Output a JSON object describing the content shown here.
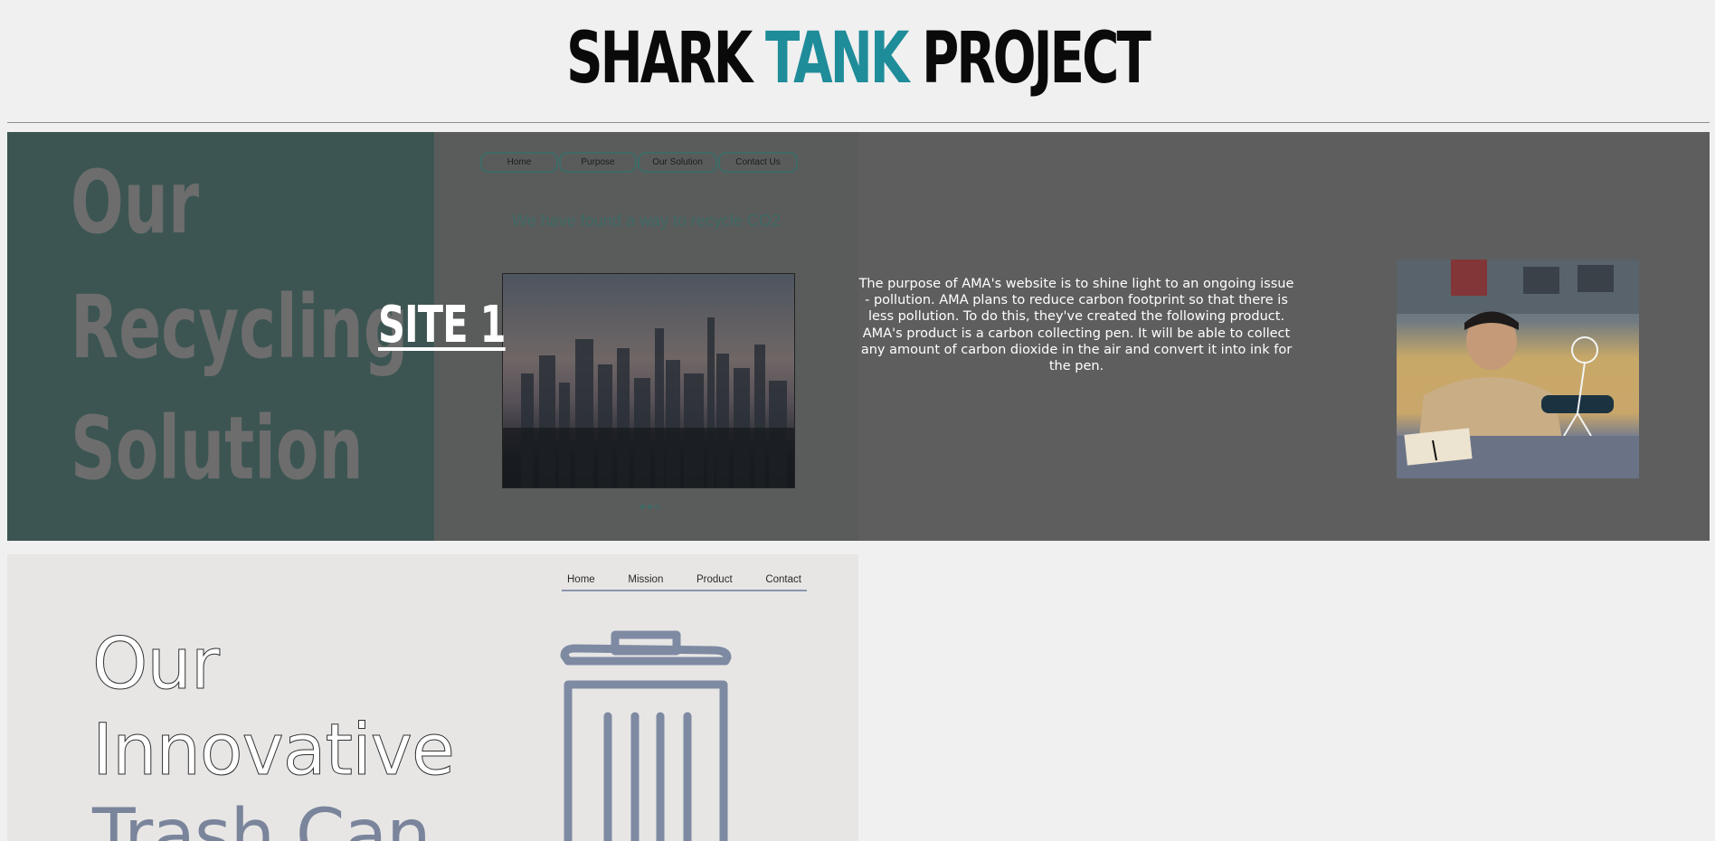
{
  "header": {
    "title_part1": "SHARK",
    "title_part2": "TANK",
    "title_part3": "PROJECT",
    "accent_color": "#1f8c99"
  },
  "site1": {
    "label": "SITE 1",
    "hero_lines": [
      "Our",
      "Recycling",
      "Solution"
    ],
    "nav": [
      "Home",
      "Purpose",
      "Our Solution",
      "Contact Us"
    ],
    "headline": "We have found a way to recycle CO2",
    "description": "The purpose of AMA's website is to shine light to an ongoing issue - pollution. AMA plans to reduce carbon footprint so that there is less pollution. To do this, they've created the following product. AMA's product is a carbon collecting pen. It will be able to collect any amount of carbon dioxide in the air and convert it into ink for the pen."
  },
  "site2": {
    "nav": [
      "Home",
      "Mission",
      "Product",
      "Contact"
    ],
    "hero_lines": [
      "Our",
      "Innovative",
      "Trash Can"
    ],
    "icon": "trash-can-icon"
  }
}
